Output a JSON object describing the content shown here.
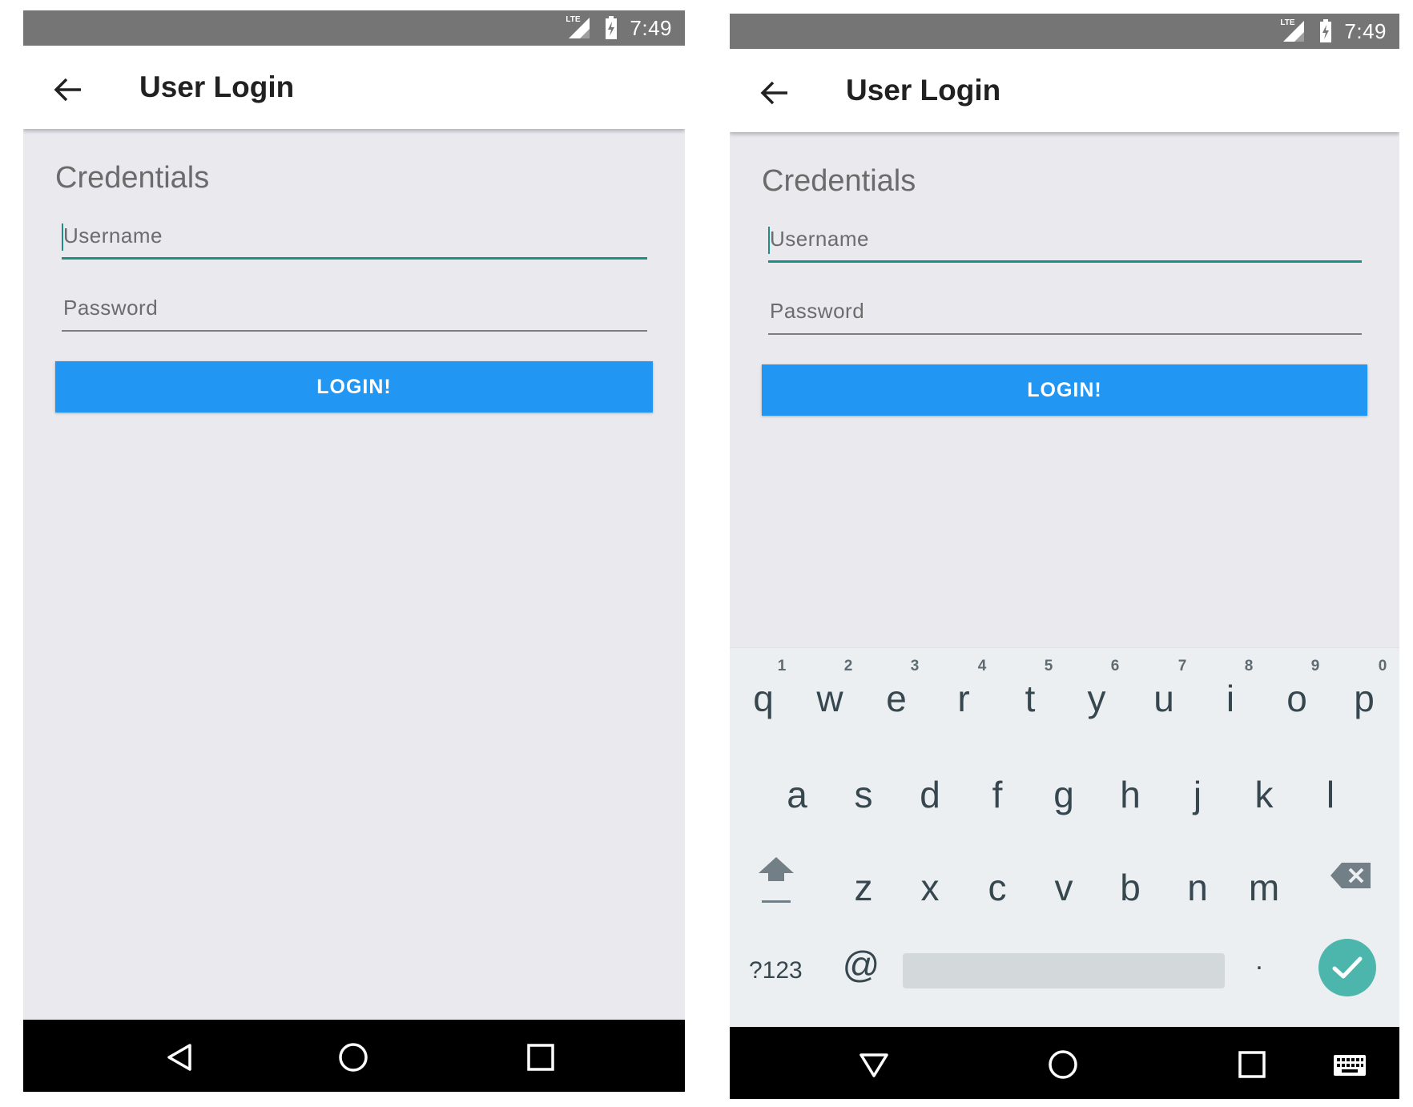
{
  "screens": [
    {
      "status": {
        "time": "7:49",
        "network": "LTE"
      },
      "app_bar": {
        "title": "User Login",
        "back_icon": "arrow-left-icon"
      },
      "form": {
        "section_title": "Credentials",
        "username_placeholder": "Username",
        "password_placeholder": "Password",
        "login_label": "LOGIN!"
      },
      "nav": {
        "back_icon": "triangle-back-icon",
        "home_icon": "circle-home-icon",
        "recents_icon": "square-recents-icon"
      }
    },
    {
      "status": {
        "time": "7:49",
        "network": "LTE"
      },
      "app_bar": {
        "title": "User Login",
        "back_icon": "arrow-left-icon"
      },
      "form": {
        "section_title": "Credentials",
        "username_placeholder": "Username",
        "password_placeholder": "Password",
        "login_label": "LOGIN!"
      },
      "keyboard": {
        "row1": [
          {
            "key": "q",
            "hint": "1"
          },
          {
            "key": "w",
            "hint": "2"
          },
          {
            "key": "e",
            "hint": "3"
          },
          {
            "key": "r",
            "hint": "4"
          },
          {
            "key": "t",
            "hint": "5"
          },
          {
            "key": "y",
            "hint": "6"
          },
          {
            "key": "u",
            "hint": "7"
          },
          {
            "key": "i",
            "hint": "8"
          },
          {
            "key": "o",
            "hint": "9"
          },
          {
            "key": "p",
            "hint": "0"
          }
        ],
        "row2": [
          "a",
          "s",
          "d",
          "f",
          "g",
          "h",
          "j",
          "k",
          "l"
        ],
        "row3": [
          "z",
          "x",
          "c",
          "v",
          "b",
          "n",
          "m"
        ],
        "symbols_label": "?123",
        "at_label": "@",
        "period_label": ".",
        "shift_icon": "shift-arrow-icon",
        "delete_icon": "backspace-icon",
        "enter_icon": "checkmark-icon"
      },
      "nav": {
        "back_icon": "triangle-down-icon",
        "home_icon": "circle-home-icon",
        "recents_icon": "square-recents-icon",
        "keyboard_icon": "keyboard-icon"
      }
    }
  ],
  "colors": {
    "status_bar": "#757575",
    "accent_teal": "#1b8f83",
    "button_blue": "#2196f3",
    "enter_teal": "#4db6ac",
    "background": "#e9e9ee"
  }
}
